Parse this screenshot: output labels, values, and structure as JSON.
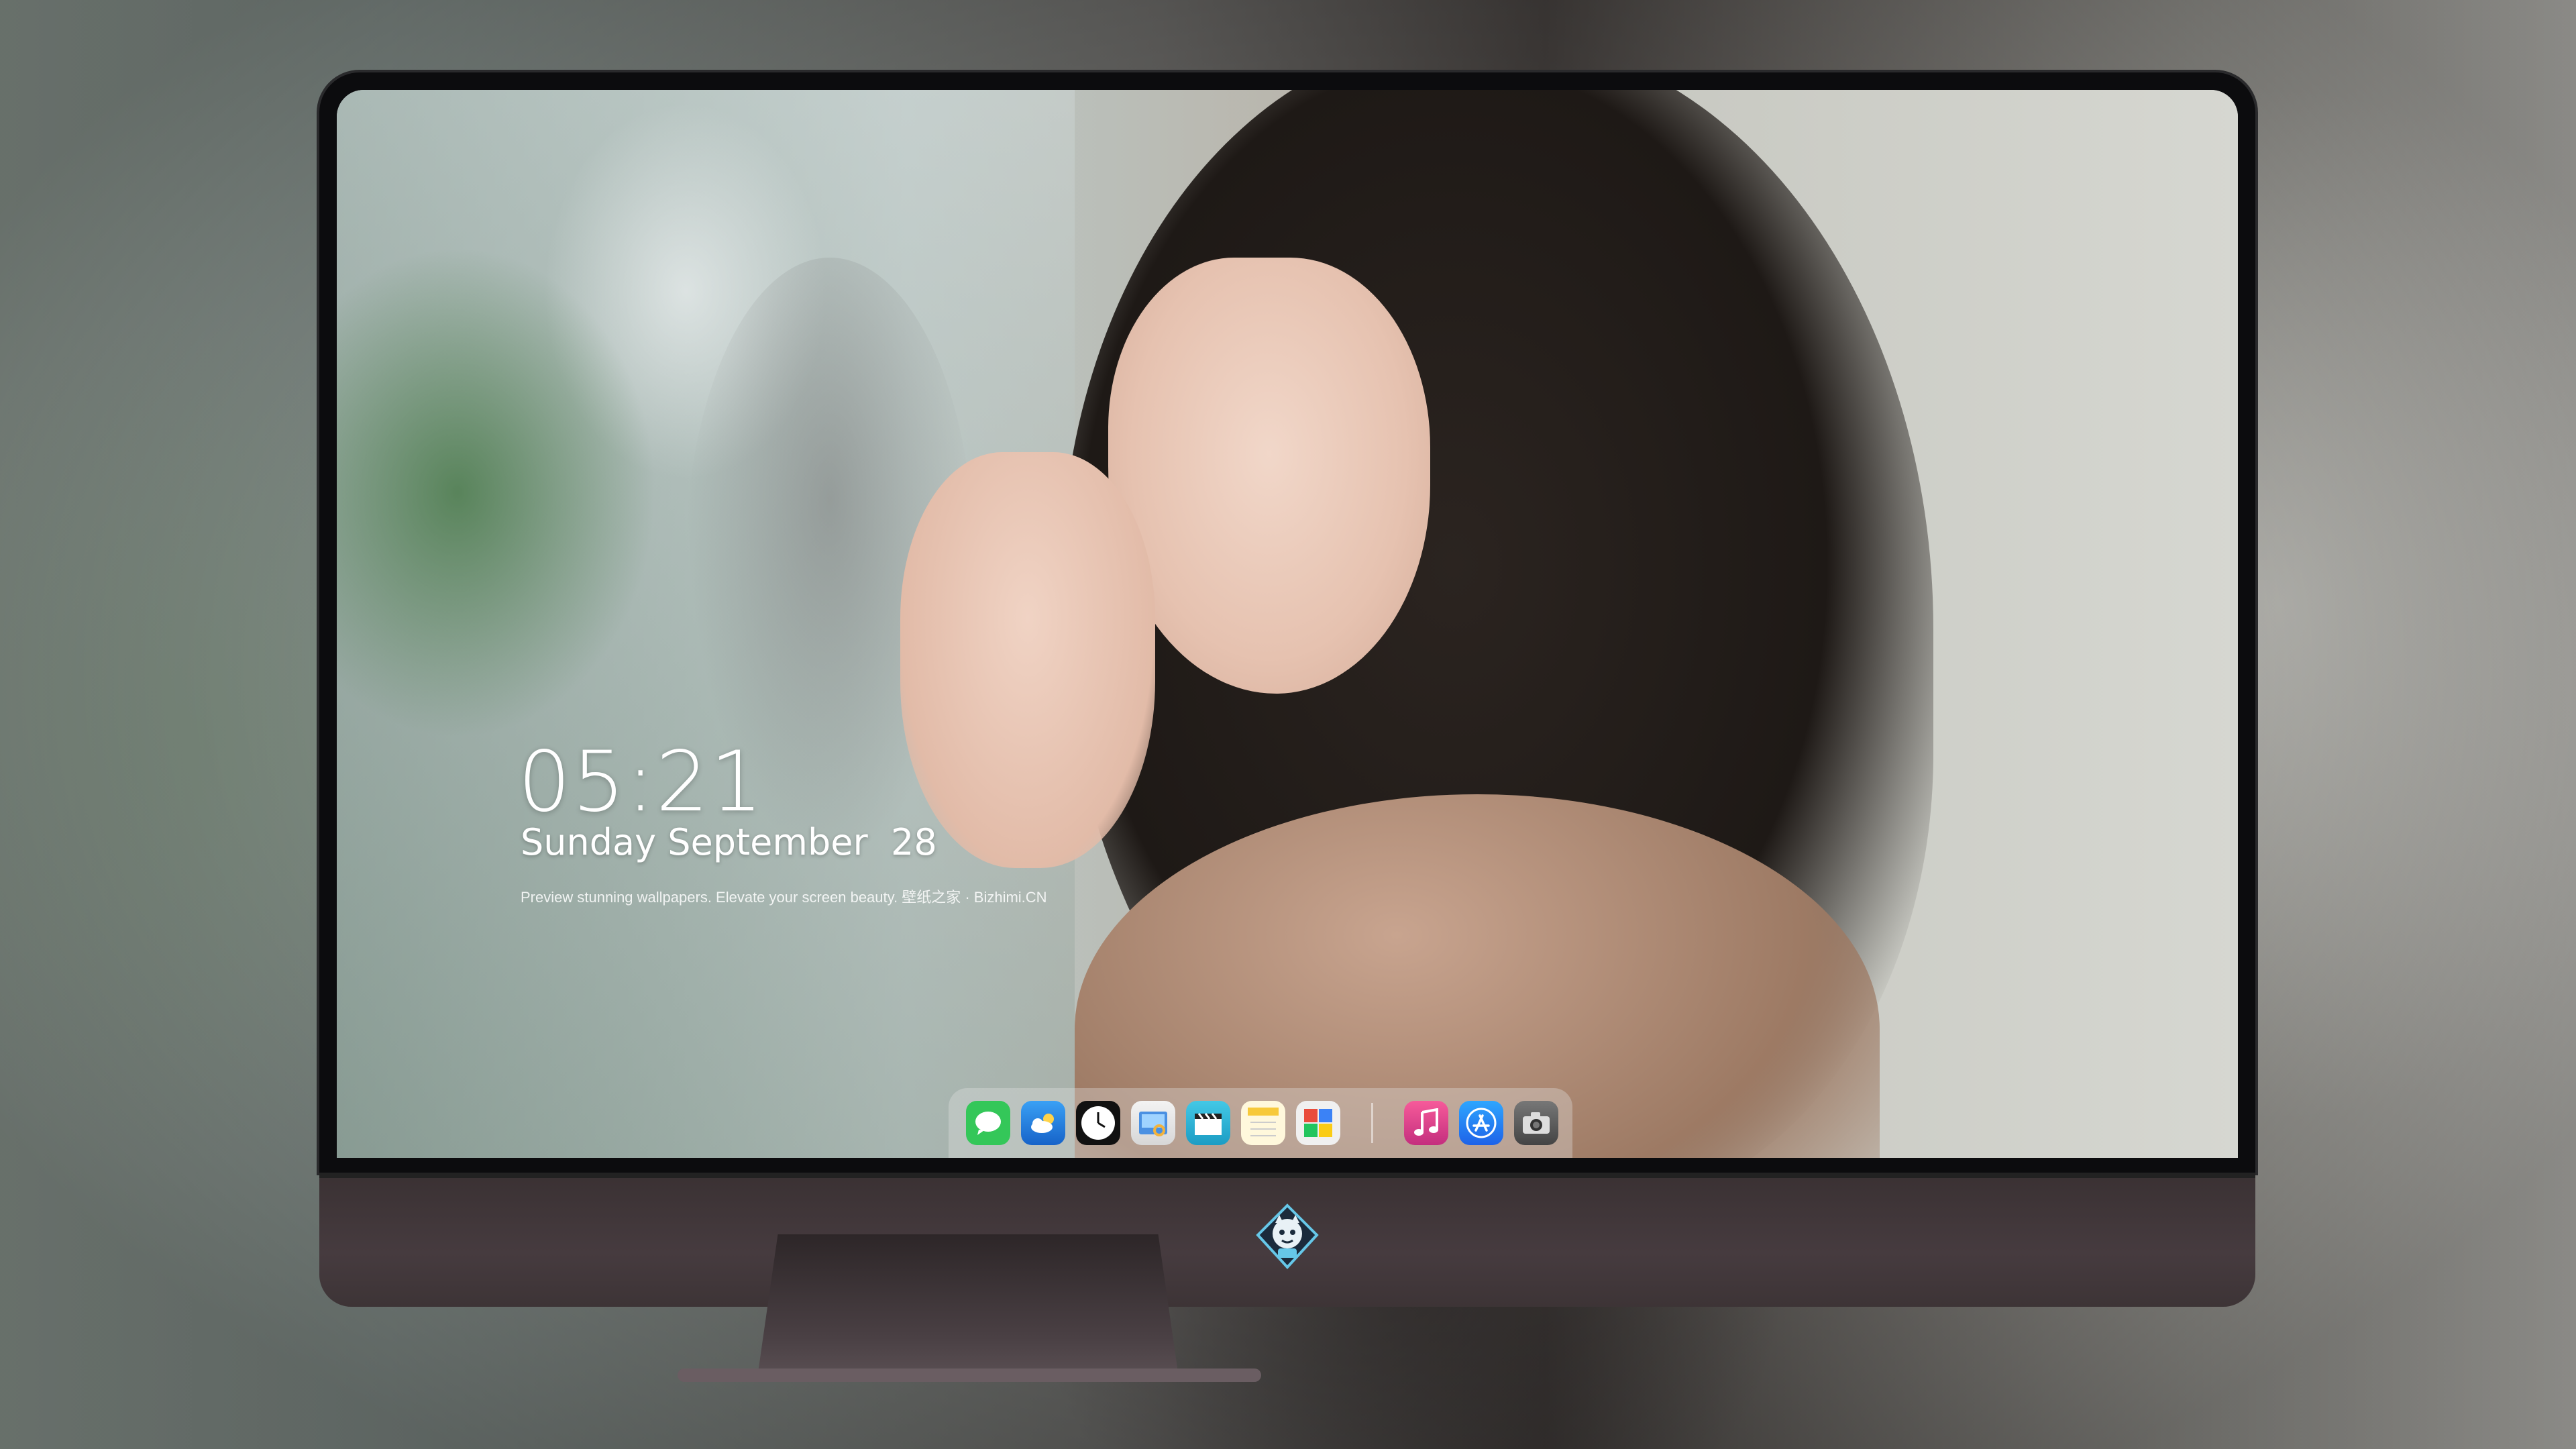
{
  "lock_screen": {
    "time": "05:21",
    "date": "Sunday September  28",
    "tagline": "Preview stunning wallpapers. Elevate your screen beauty. 壁纸之家 · Bizhimi.CN"
  },
  "dock": {
    "apps": [
      {
        "name": "Messages",
        "icon": "message-bubble-icon",
        "glyph": "💬",
        "color": "#34c759"
      },
      {
        "name": "Weather",
        "icon": "weather-cloud-icon",
        "glyph": "☁",
        "color": "#1e88e5"
      },
      {
        "name": "Clock",
        "icon": "clock-icon",
        "glyph": "🕐",
        "color": "#111111"
      },
      {
        "name": "Preview",
        "icon": "preview-icon",
        "glyph": "🖼",
        "color": "#f6c24a"
      },
      {
        "name": "Clips",
        "icon": "clapperboard-icon",
        "glyph": "🎬",
        "color": "#28b8d6"
      },
      {
        "name": "Notes",
        "icon": "notes-icon",
        "glyph": "≡",
        "color": "#f7d34a"
      },
      {
        "name": "Photo Booth",
        "icon": "photo-booth-icon",
        "glyph": "▦",
        "color": "#e94c3c"
      },
      {
        "name": "Music",
        "icon": "music-note-icon",
        "glyph": "♫",
        "color": "#e0468e"
      },
      {
        "name": "App Store",
        "icon": "app-store-icon",
        "glyph": "A",
        "color": "#1f7cf0"
      },
      {
        "name": "Camera",
        "icon": "camera-icon",
        "glyph": "◉",
        "color": "#555555"
      }
    ]
  },
  "chin": {
    "logo_icon": "mascot-logo-icon"
  }
}
